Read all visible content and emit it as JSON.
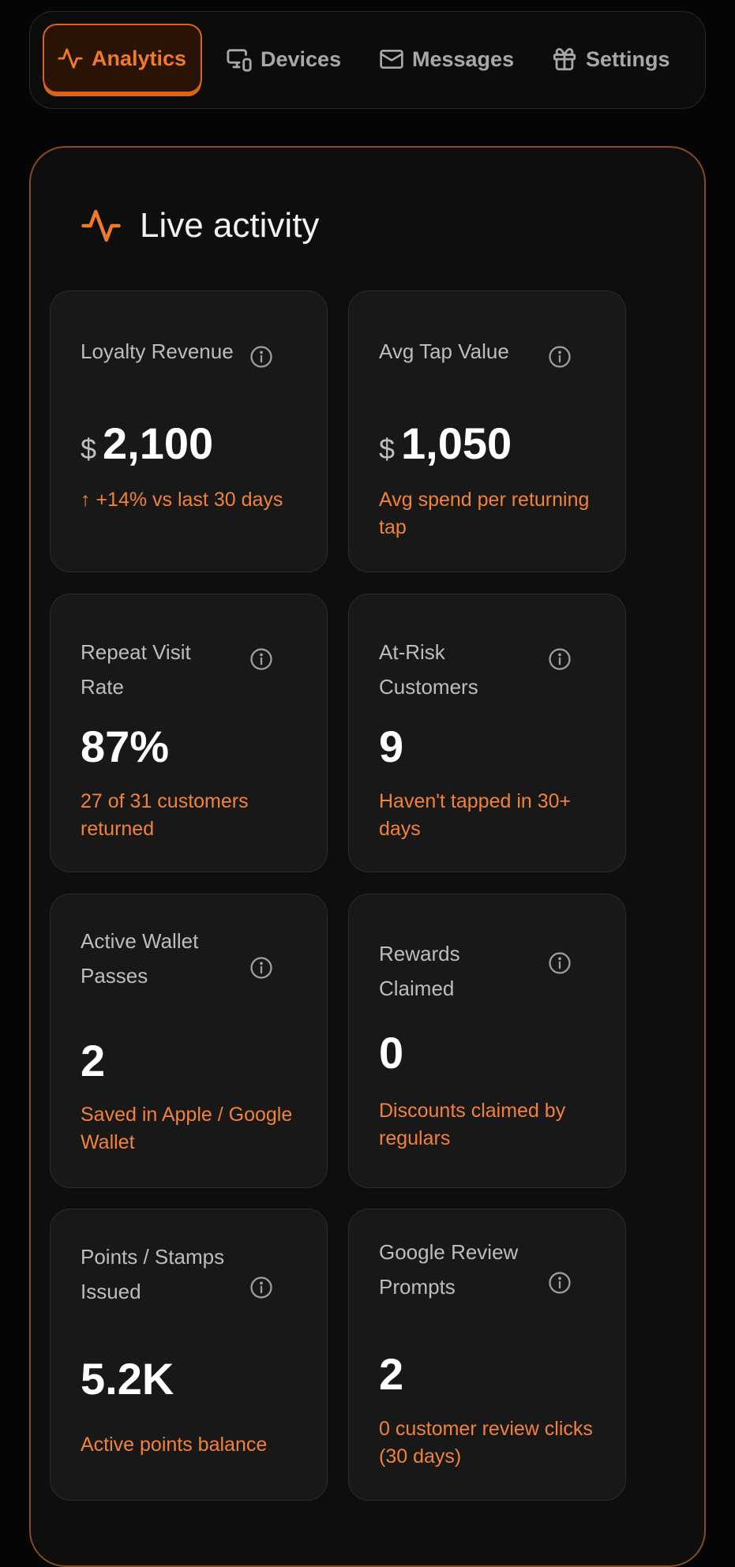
{
  "nav": {
    "tabs": [
      {
        "label": "Analytics",
        "icon": "activity-icon",
        "active": true
      },
      {
        "label": "Devices",
        "icon": "devices-icon",
        "active": false
      },
      {
        "label": "Messages",
        "icon": "mail-icon",
        "active": false
      },
      {
        "label": "Settings",
        "icon": "gift-icon",
        "active": false
      }
    ]
  },
  "panel": {
    "title": "Live activity",
    "icon": "activity-icon",
    "accent": "#f07a2a"
  },
  "cards": [
    {
      "label": "Loyalty Revenue",
      "currency": "$",
      "value": "2,100",
      "sub": "↑ +14% vs last 30 days"
    },
    {
      "label": "Avg Tap Value",
      "currency": "$",
      "value": "1,050",
      "sub": "Avg spend per returning tap"
    },
    {
      "label": "Repeat Visit Rate",
      "currency": "",
      "value": "87%",
      "sub": "27 of 31 customers returned"
    },
    {
      "label": "At-Risk Customers",
      "currency": "",
      "value": "9",
      "sub": "Haven't tapped in 30+ days"
    },
    {
      "label": "Active Wallet Passes",
      "currency": "",
      "value": "2",
      "sub": "Saved in Apple / Google Wallet"
    },
    {
      "label": "Rewards Claimed",
      "currency": "",
      "value": "0",
      "sub": "Discounts claimed by regulars"
    },
    {
      "label": "Points / Stamps Issued",
      "currency": "",
      "value": "5.2K",
      "sub": "Active points balance"
    },
    {
      "label": "Google Review Prompts",
      "currency": "",
      "value": "2",
      "sub": "0 customer review clicks (30 days)"
    }
  ]
}
